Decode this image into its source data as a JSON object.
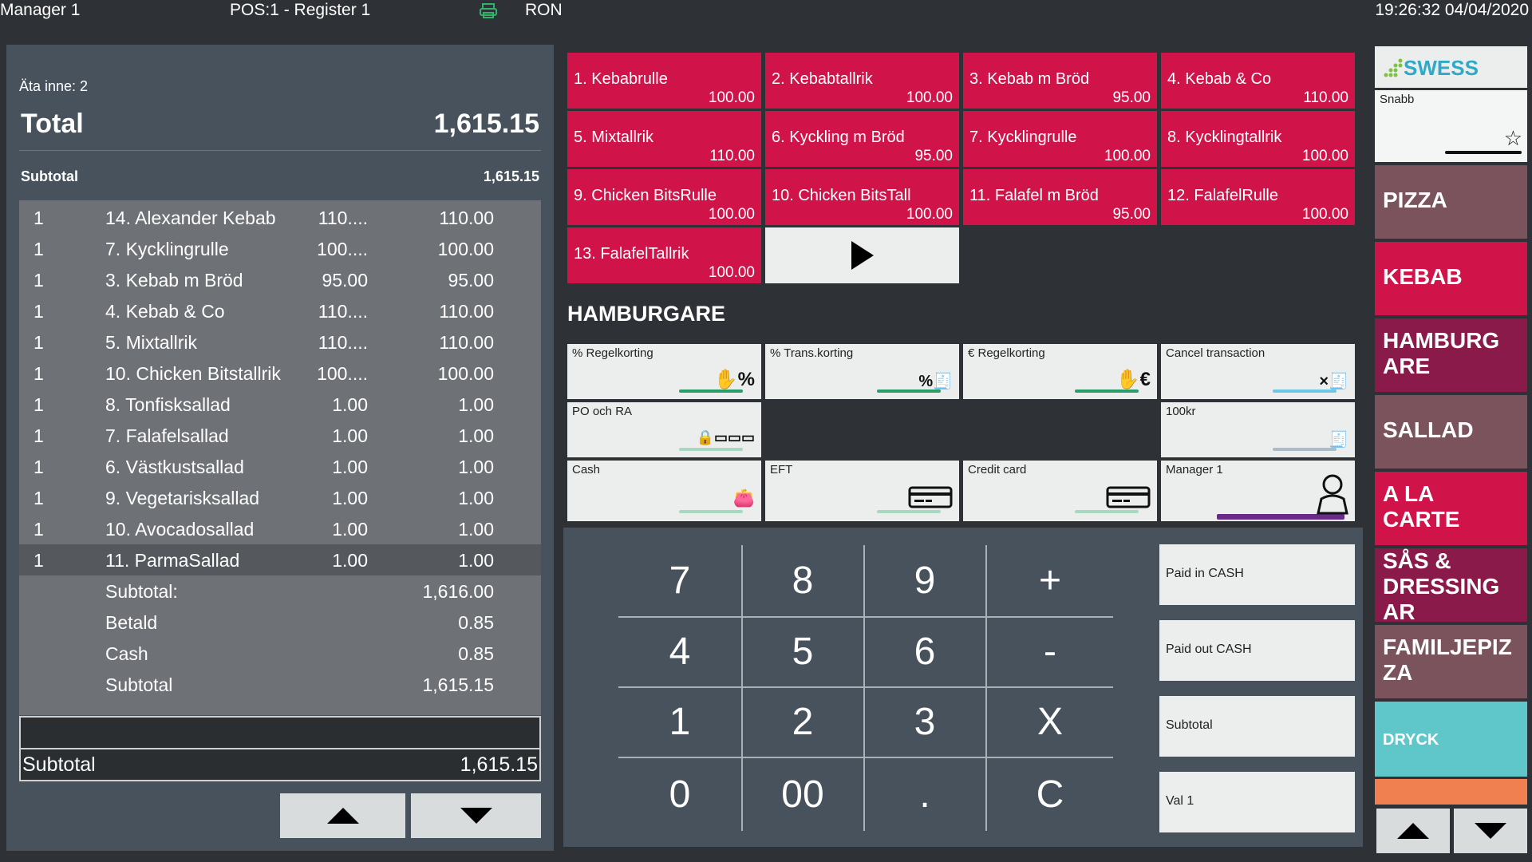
{
  "topbar": {
    "user": "Manager 1",
    "register": "POS:1 - Register 1",
    "printer_icon": "printer-icon",
    "currency": "RON",
    "clock": "19:26:32  04/04/2020"
  },
  "order": {
    "eat_in": "Äta inne: 2",
    "total_label": "Total",
    "total_value": "1,615.15",
    "subtotal_label": "Subtotal",
    "subtotal_value": "1,615.15",
    "rows": [
      {
        "qty": "1",
        "name": "14. Alexander Kebab",
        "price": "110....",
        "total": "110.00"
      },
      {
        "qty": "1",
        "name": "7. Kycklingrulle",
        "price": "100....",
        "total": "100.00"
      },
      {
        "qty": "1",
        "name": "3. Kebab m Bröd",
        "price": "95.00",
        "total": "95.00"
      },
      {
        "qty": "1",
        "name": "4. Kebab & Co",
        "price": "110....",
        "total": "110.00"
      },
      {
        "qty": "1",
        "name": "5. Mixtallrik",
        "price": "110....",
        "total": "110.00"
      },
      {
        "qty": "1",
        "name": "10. Chicken Bitstallrik",
        "price": "100....",
        "total": "100.00"
      },
      {
        "qty": "1",
        "name": "8. Tonfisksallad",
        "price": "1.00",
        "total": "1.00"
      },
      {
        "qty": "1",
        "name": "7. Falafelsallad",
        "price": "1.00",
        "total": "1.00"
      },
      {
        "qty": "1",
        "name": "6. Västkustsallad",
        "price": "1.00",
        "total": "1.00"
      },
      {
        "qty": "1",
        "name": "9. Vegetarisksallad",
        "price": "1.00",
        "total": "1.00"
      },
      {
        "qty": "1",
        "name": "10. Avocadosallad",
        "price": "1.00",
        "total": "1.00"
      },
      {
        "qty": "1",
        "name": "11. ParmaSallad",
        "price": "1.00",
        "total": "1.00"
      }
    ],
    "summary": [
      {
        "label": "Subtotal:",
        "value": "1,616.00"
      },
      {
        "label": "Betald",
        "value": "0.85"
      },
      {
        "label": "Cash",
        "value": "0.85"
      },
      {
        "label": "Subtotal",
        "value": "1,615.15"
      }
    ],
    "footer_label": "Subtotal",
    "footer_value": "1,615.15"
  },
  "products": [
    {
      "name": "1. Kebabrulle",
      "price": "100.00"
    },
    {
      "name": "2. Kebabtallrik",
      "price": "100.00"
    },
    {
      "name": "3. Kebab m Bröd",
      "price": "95.00"
    },
    {
      "name": "4. Kebab & Co",
      "price": "110.00"
    },
    {
      "name": "5. Mixtallrik",
      "price": "110.00"
    },
    {
      "name": "6. Kyckling m Bröd",
      "price": "95.00"
    },
    {
      "name": "7. Kycklingrulle",
      "price": "100.00"
    },
    {
      "name": "8. Kycklingtallrik",
      "price": "100.00"
    },
    {
      "name": "9. Chicken BitsRulle",
      "price": "100.00"
    },
    {
      "name": "10. Chicken BitsTall",
      "price": "100.00"
    },
    {
      "name": "11. Falafel m Bröd",
      "price": "95.00"
    },
    {
      "name": "12. FalafelRulle",
      "price": "100.00"
    },
    {
      "name": "13. FalafelTallrik",
      "price": "100.00"
    }
  ],
  "section_title": "HAMBURGARE",
  "functions": {
    "regelkorting_pct": "% Regelkorting",
    "trans_korting": "% Trans.korting",
    "regelkorting_eur": "€ Regelkorting",
    "cancel": "Cancel transaction",
    "po_ra": "PO och RA",
    "hundred": "100kr",
    "cash": "Cash",
    "eft": "EFT",
    "credit": "Credit card",
    "manager": "Manager 1"
  },
  "keypad": {
    "k7": "7",
    "k8": "8",
    "k9": "9",
    "plus": "+",
    "k4": "4",
    "k5": "5",
    "k6": "6",
    "minus": "-",
    "k1": "1",
    "k2": "2",
    "k3": "3",
    "times": "X",
    "k0": "0",
    "k00": "00",
    "dot": ".",
    "clear": "C"
  },
  "side_buttons": [
    "Paid in CASH",
    "Paid out CASH",
    "Subtotal",
    "Val 1"
  ],
  "brand": "SWESS",
  "quick": "Snabb",
  "categories": [
    {
      "label": "PIZZA",
      "color": "#7a535c"
    },
    {
      "label": "KEBAB",
      "color": "#d0144a"
    },
    {
      "label": "HAMBURG ARE",
      "color": "#8a1a4a"
    },
    {
      "label": "SALLAD",
      "color": "#7a535c"
    },
    {
      "label": "A LA CARTE",
      "color": "#d0144a"
    },
    {
      "label": "SÅS & DRESSING AR",
      "color": "#8a1a4a"
    },
    {
      "label": "FAMILJEPIZ ZA",
      "color": "#7a535c"
    },
    {
      "label": "DRYCK",
      "color": "#5fc7c9"
    }
  ],
  "colors": {
    "accent_red": "#d0144a",
    "panel": "#48525c",
    "teal": "#5fc7c9",
    "orange": "#f08050"
  }
}
